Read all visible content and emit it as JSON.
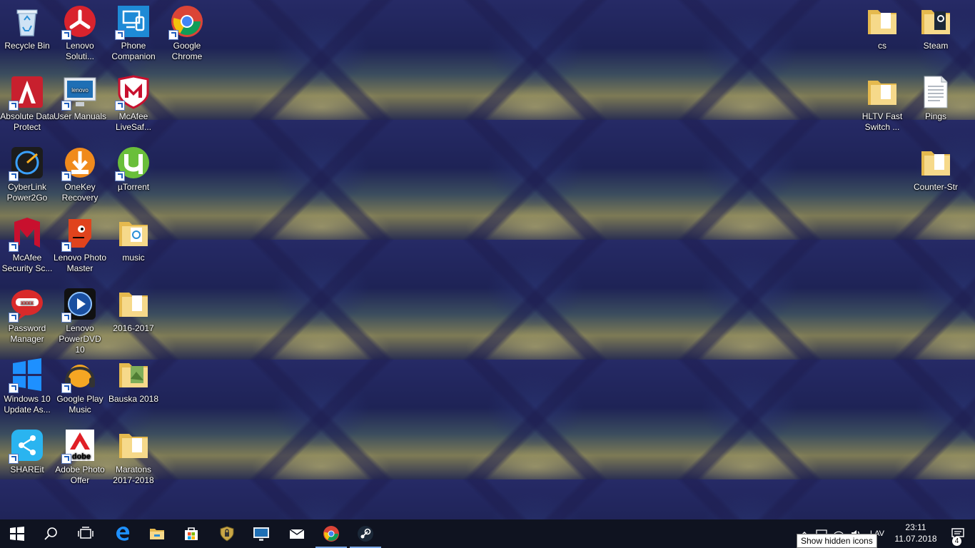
{
  "desktop_icons": [
    {
      "id": "recycle-bin",
      "label": "Recycle Bin",
      "icon": "recycle-bin-icon",
      "color": "#9fc3e9"
    },
    {
      "id": "lenovo-solution",
      "label": "Lenovo Soluti...",
      "icon": "lenovo-solution-icon",
      "color": "#d9232d"
    },
    {
      "id": "phone-companion",
      "label": "Phone Companion",
      "icon": "phone-companion-icon",
      "color": "#1e8ad6"
    },
    {
      "id": "google-chrome",
      "label": "Google Chrome",
      "icon": "chrome-icon",
      "color": "#dd4b39"
    },
    {
      "id": "absolute-data-protect",
      "label": "Absolute Data Protect",
      "icon": "absolute-icon",
      "color": "#cc2030"
    },
    {
      "id": "user-manuals",
      "label": "User Manuals",
      "icon": "monitor-icon",
      "color": "#1f6fb5"
    },
    {
      "id": "mcafee-livesafe",
      "label": "McAfee LiveSaf...",
      "icon": "mcafee-shield-icon",
      "color": "#c8102e"
    },
    {
      "id": "cyberlink-power2go",
      "label": "CyberLink Power2Go",
      "icon": "power2go-icon",
      "color": "#222222"
    },
    {
      "id": "onekey-recovery",
      "label": "OneKey Recovery",
      "icon": "onekey-recovery-icon",
      "color": "#f08a1c"
    },
    {
      "id": "utorrent",
      "label": "µTorrent",
      "icon": "utorrent-icon",
      "color": "#6abf3a"
    },
    {
      "id": "mcafee-security-scan",
      "label": "McAfee Security Sc...",
      "icon": "mcafee-icon",
      "color": "#c8102e"
    },
    {
      "id": "lenovo-photo-master",
      "label": "Lenovo Photo Master",
      "icon": "photo-master-icon",
      "color": "#e0431d"
    },
    {
      "id": "music",
      "label": "music",
      "icon": "folder-icon",
      "color": "#f2d27a"
    },
    {
      "id": "password-manager",
      "label": "Password Manager",
      "icon": "password-manager-icon",
      "color": "#d92a2a"
    },
    {
      "id": "lenovo-powerdvd",
      "label": "Lenovo PowerDVD 10",
      "icon": "powerdvd-icon",
      "color": "#1a4fa0"
    },
    {
      "id": "folder-2016-2017",
      "label": "2016-2017",
      "icon": "folder-icon",
      "color": "#f2d27a"
    },
    {
      "id": "windows-10-update",
      "label": "Windows 10 Update As...",
      "icon": "windows-icon",
      "color": "#1e90ff"
    },
    {
      "id": "google-play-music",
      "label": "Google Play Music",
      "icon": "headphones-icon",
      "color": "#f5a623"
    },
    {
      "id": "bauska-2018",
      "label": "Bauska 2018",
      "icon": "folder-icon",
      "color": "#f2d27a"
    },
    {
      "id": "shareit",
      "label": "SHAREit",
      "icon": "shareit-icon",
      "color": "#2ab4f0"
    },
    {
      "id": "adobe-photo-offer",
      "label": "Adobe Photo Offer",
      "icon": "adobe-icon",
      "color": "#e01f26"
    },
    {
      "id": "maratons",
      "label": "Maratons 2017-2018",
      "icon": "folder-icon",
      "color": "#f2d27a"
    },
    {
      "id": "cs",
      "label": "cs",
      "icon": "folder-icon",
      "color": "#f2d27a"
    },
    {
      "id": "steam-folder",
      "label": "Steam",
      "icon": "folder-icon",
      "color": "#f2d27a"
    },
    {
      "id": "hltv-fast-switch",
      "label": "HLTV Fast Switch ...",
      "icon": "folder-icon",
      "color": "#f2d27a"
    },
    {
      "id": "pings",
      "label": "Pings",
      "icon": "document-icon",
      "color": "#ffffff"
    },
    {
      "id": "counter-strike",
      "label": "Counter-Str",
      "icon": "folder-icon",
      "color": "#f2d27a"
    }
  ],
  "taskbar": {
    "items": [
      {
        "id": "start",
        "icon": "windows-start-icon"
      },
      {
        "id": "search",
        "icon": "search-icon"
      },
      {
        "id": "task-view",
        "icon": "task-view-icon"
      },
      {
        "id": "edge",
        "icon": "edge-icon"
      },
      {
        "id": "file-explorer",
        "icon": "folder-icon"
      },
      {
        "id": "store",
        "icon": "store-icon"
      },
      {
        "id": "security",
        "icon": "shield-icon"
      },
      {
        "id": "lenovo",
        "icon": "monitor-icon"
      },
      {
        "id": "mail",
        "icon": "mail-icon"
      },
      {
        "id": "chrome",
        "icon": "chrome-icon"
      },
      {
        "id": "steam",
        "icon": "steam-icon"
      }
    ],
    "tray": {
      "language": "LAV",
      "time": "23:11",
      "date": "11.07.2018",
      "notification_count": "4",
      "tooltip": "Show hidden icons"
    }
  },
  "colors": {
    "taskbar": "#0f1320",
    "accent": "#7aa7e6"
  }
}
